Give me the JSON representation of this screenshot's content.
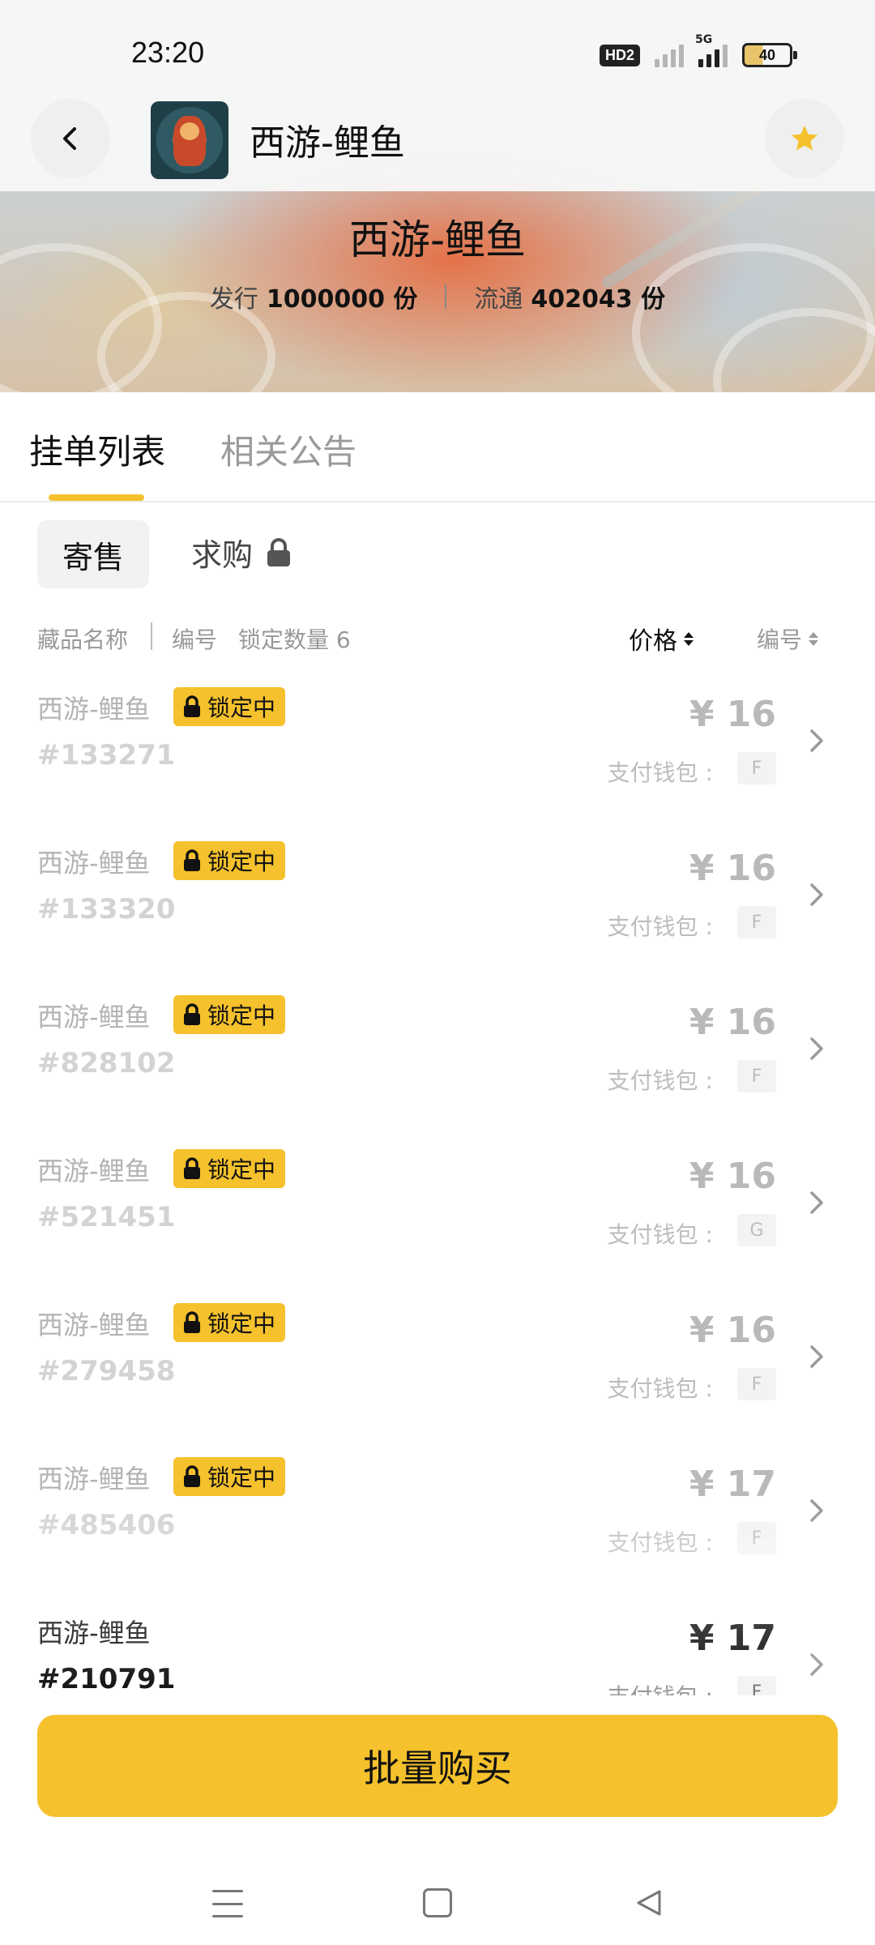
{
  "status_bar": {
    "time": "23:20",
    "hd_badge": "HD2",
    "network_5g": "5G",
    "battery": "40"
  },
  "header": {
    "title": "西游-鲤鱼",
    "back_icon": "chevron-left-icon",
    "favorite_icon": "star-icon",
    "favorite_color": "#F5C12C"
  },
  "hero": {
    "title": "西游-鲤鱼",
    "issue_label": "发行",
    "issue_value": "1000000 份",
    "circulation_label": "流通",
    "circulation_value": "402043 份"
  },
  "tabs": {
    "listings": "挂单列表",
    "announcements": "相关公告"
  },
  "subtabs": {
    "sell": "寄售",
    "buy": "求购"
  },
  "filters": {
    "name": "藏品名称",
    "number": "编号",
    "locked_count": "锁定数量 6",
    "sort_price": "价格",
    "sort_number": "编号"
  },
  "listings": [
    {
      "name": "西游-鲤鱼",
      "locked": true,
      "lock_label": "锁定中",
      "serial": "#133271",
      "price": "¥ 16",
      "wallet_label": "支付钱包 :",
      "wallet": "F"
    },
    {
      "name": "西游-鲤鱼",
      "locked": true,
      "lock_label": "锁定中",
      "serial": "#133320",
      "price": "¥ 16",
      "wallet_label": "支付钱包 :",
      "wallet": "F"
    },
    {
      "name": "西游-鲤鱼",
      "locked": true,
      "lock_label": "锁定中",
      "serial": "#828102",
      "price": "¥ 16",
      "wallet_label": "支付钱包 :",
      "wallet": "F"
    },
    {
      "name": "西游-鲤鱼",
      "locked": true,
      "lock_label": "锁定中",
      "serial": "#521451",
      "price": "¥ 16",
      "wallet_label": "支付钱包 :",
      "wallet": "G"
    },
    {
      "name": "西游-鲤鱼",
      "locked": true,
      "lock_label": "锁定中",
      "serial": "#279458",
      "price": "¥ 16",
      "wallet_label": "支付钱包 :",
      "wallet": "F"
    },
    {
      "name": "西游-鲤鱼",
      "locked": true,
      "lock_label": "锁定中",
      "serial": "#485406",
      "price": "¥ 17",
      "wallet_label": "支付钱包 :",
      "wallet": "F"
    },
    {
      "name": "西游-鲤鱼",
      "locked": false,
      "lock_label": "",
      "serial": "#210791",
      "price": "¥ 17",
      "wallet_label": "支付钱包 :",
      "wallet": "F"
    }
  ],
  "actions": {
    "bulk_buy": "批量购买",
    "accent_color": "#F5C12C"
  },
  "system_nav": {
    "menu_icon": "menu-icon",
    "home_icon": "home-icon",
    "back_icon": "triangle-back-icon"
  }
}
